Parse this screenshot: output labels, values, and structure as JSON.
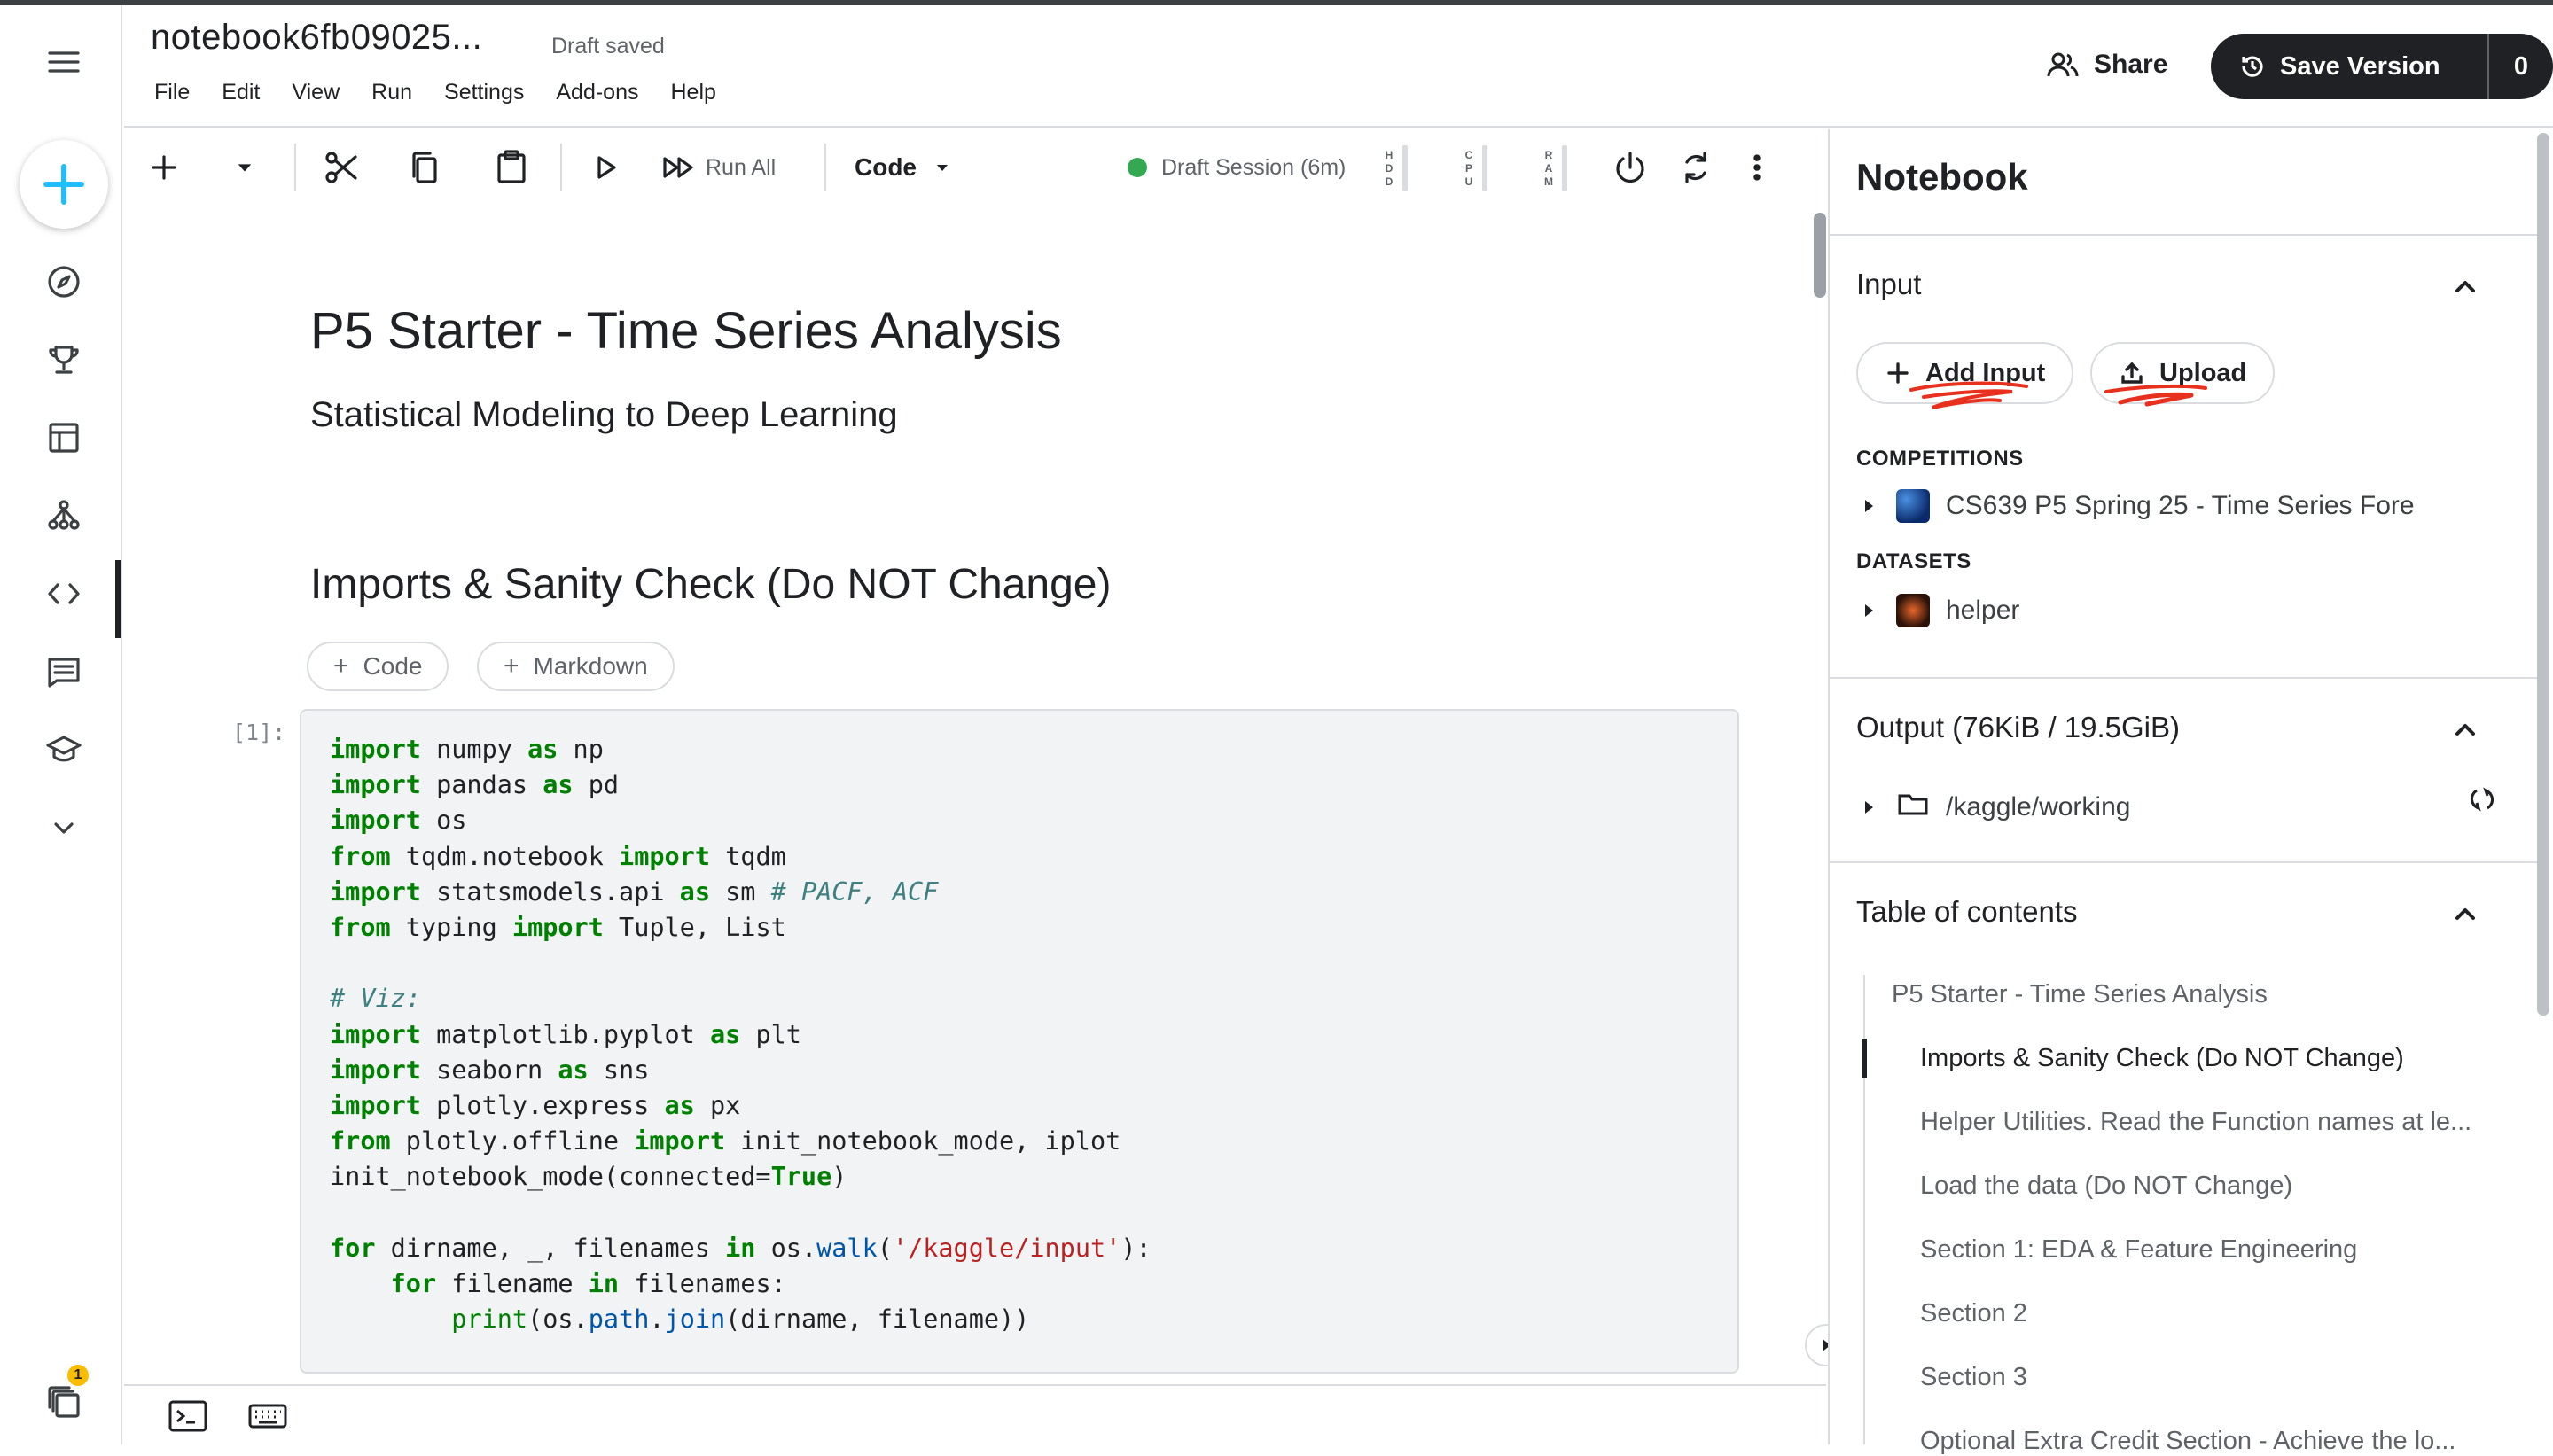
{
  "header": {
    "notebook_title": "notebook6fb09025...",
    "save_status": "Draft saved",
    "menu": [
      "File",
      "Edit",
      "View",
      "Run",
      "Settings",
      "Add-ons",
      "Help"
    ],
    "share_label": "Share",
    "save_version_label": "Save Version",
    "save_version_count": "0"
  },
  "sidebar": {
    "items": [
      "create",
      "compass",
      "trophy",
      "table",
      "models",
      "code",
      "comments",
      "learn",
      "more"
    ],
    "active_item": "code",
    "notification_count": "1"
  },
  "toolbar": {
    "run_all_label": "Run All",
    "cell_type": "Code",
    "session_label": "Draft Session (6m)",
    "meters": [
      "HDD",
      "CPU",
      "RAM"
    ]
  },
  "notebook": {
    "title": "P5 Starter - Time Series Analysis",
    "subtitle": "Statistical Modeling to Deep Learning",
    "section_heading": "Imports & Sanity Check (Do NOT Change)",
    "add_code_label": "Code",
    "add_markdown_label": "Markdown",
    "exec_count": "[1]:",
    "code_lines": [
      "import numpy as np",
      "import pandas as pd",
      "import os",
      "from tqdm.notebook import tqdm",
      "import statsmodels.api as sm # PACF, ACF",
      "from typing import Tuple, List",
      "",
      "# Viz:",
      "import matplotlib.pyplot as plt",
      "import seaborn as sns",
      "import plotly.express as px",
      "from plotly.offline import init_notebook_mode, iplot",
      "init_notebook_mode(connected=True)",
      "",
      "for dirname, _, filenames in os.walk('/kaggle/input'):",
      "    for filename in filenames:",
      "        print(os.path.join(dirname, filename))"
    ]
  },
  "panel": {
    "title": "Notebook",
    "input": {
      "title": "Input",
      "add_input_label": "Add Input",
      "upload_label": "Upload",
      "competitions_label": "COMPETITIONS",
      "competition_name": "CS639 P5 Spring 25 - Time Series Fore",
      "datasets_label": "DATASETS",
      "dataset_name": "helper"
    },
    "output": {
      "title": "Output (76KiB / 19.5GiB)",
      "path": "/kaggle/working"
    },
    "toc": {
      "title": "Table of contents",
      "items": [
        "P5 Starter - Time Series Analysis",
        "Imports & Sanity Check (Do NOT Change)",
        "Helper Utilities. Read the Function names at le...",
        "Load the data (Do NOT Change)",
        "Section 1: EDA & Feature Engineering",
        "Section 2",
        "Section 3",
        "Optional Extra Credit Section - Achieve the lo..."
      ],
      "active_index": 1
    }
  },
  "colors": {
    "accent": "#20beff",
    "session_green": "#34a853",
    "annotation_red": "#e8301e",
    "keyword_green": "#008000",
    "string_red": "#ba2121"
  }
}
